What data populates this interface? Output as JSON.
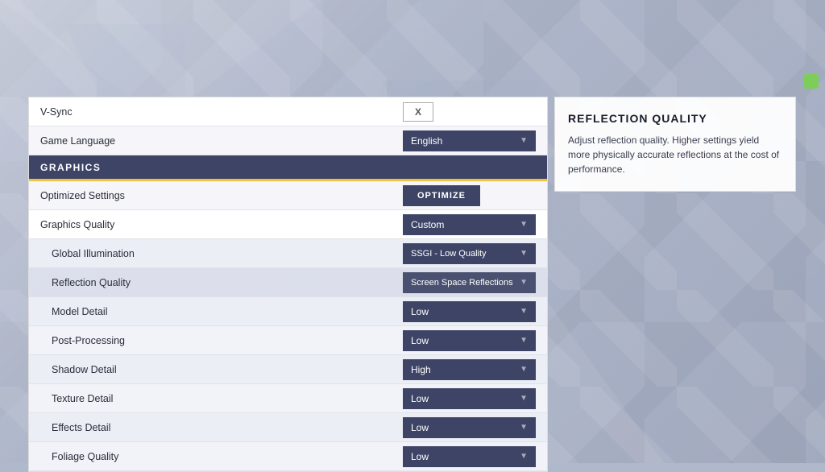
{
  "background": {
    "color": "#b0b8cc"
  },
  "status_indicator": {
    "color": "#7ccd5a"
  },
  "settings_panel": {
    "rows": [
      {
        "id": "vsync",
        "label": "V-Sync",
        "control_type": "x-button",
        "control_value": "X",
        "sub": false
      },
      {
        "id": "game-language",
        "label": "Game Language",
        "control_type": "dropdown",
        "control_value": "English",
        "sub": false
      }
    ],
    "section_header": "GRAPHICS",
    "graphics_rows": [
      {
        "id": "optimized-settings",
        "label": "Optimized Settings",
        "control_type": "button",
        "control_value": "OPTIMIZE",
        "sub": false
      },
      {
        "id": "graphics-quality",
        "label": "Graphics Quality",
        "control_type": "dropdown",
        "control_value": "Custom",
        "sub": false
      },
      {
        "id": "global-illumination",
        "label": "Global Illumination",
        "control_type": "dropdown",
        "control_value": "SSGI - Low Quality",
        "sub": true
      },
      {
        "id": "reflection-quality",
        "label": "Reflection Quality",
        "control_type": "dropdown",
        "control_value": "Screen Space Reflections",
        "sub": true
      },
      {
        "id": "model-detail",
        "label": "Model Detail",
        "control_type": "dropdown",
        "control_value": "Low",
        "sub": true
      },
      {
        "id": "post-processing",
        "label": "Post-Processing",
        "control_type": "dropdown",
        "control_value": "Low",
        "sub": true
      },
      {
        "id": "shadow-detail",
        "label": "Shadow Detail",
        "control_type": "dropdown",
        "control_value": "High",
        "sub": true
      },
      {
        "id": "texture-detail",
        "label": "Texture Detail",
        "control_type": "dropdown",
        "control_value": "Low",
        "sub": true
      },
      {
        "id": "effects-detail",
        "label": "Effects Detail",
        "control_type": "dropdown",
        "control_value": "Low",
        "sub": true
      },
      {
        "id": "foliage-quality",
        "label": "Foliage Quality",
        "control_type": "dropdown",
        "control_value": "Low",
        "sub": true
      }
    ]
  },
  "info_panel": {
    "title": "REFLECTION QUALITY",
    "description": "Adjust reflection quality. Higher settings yield more physically accurate reflections at the cost of performance."
  }
}
